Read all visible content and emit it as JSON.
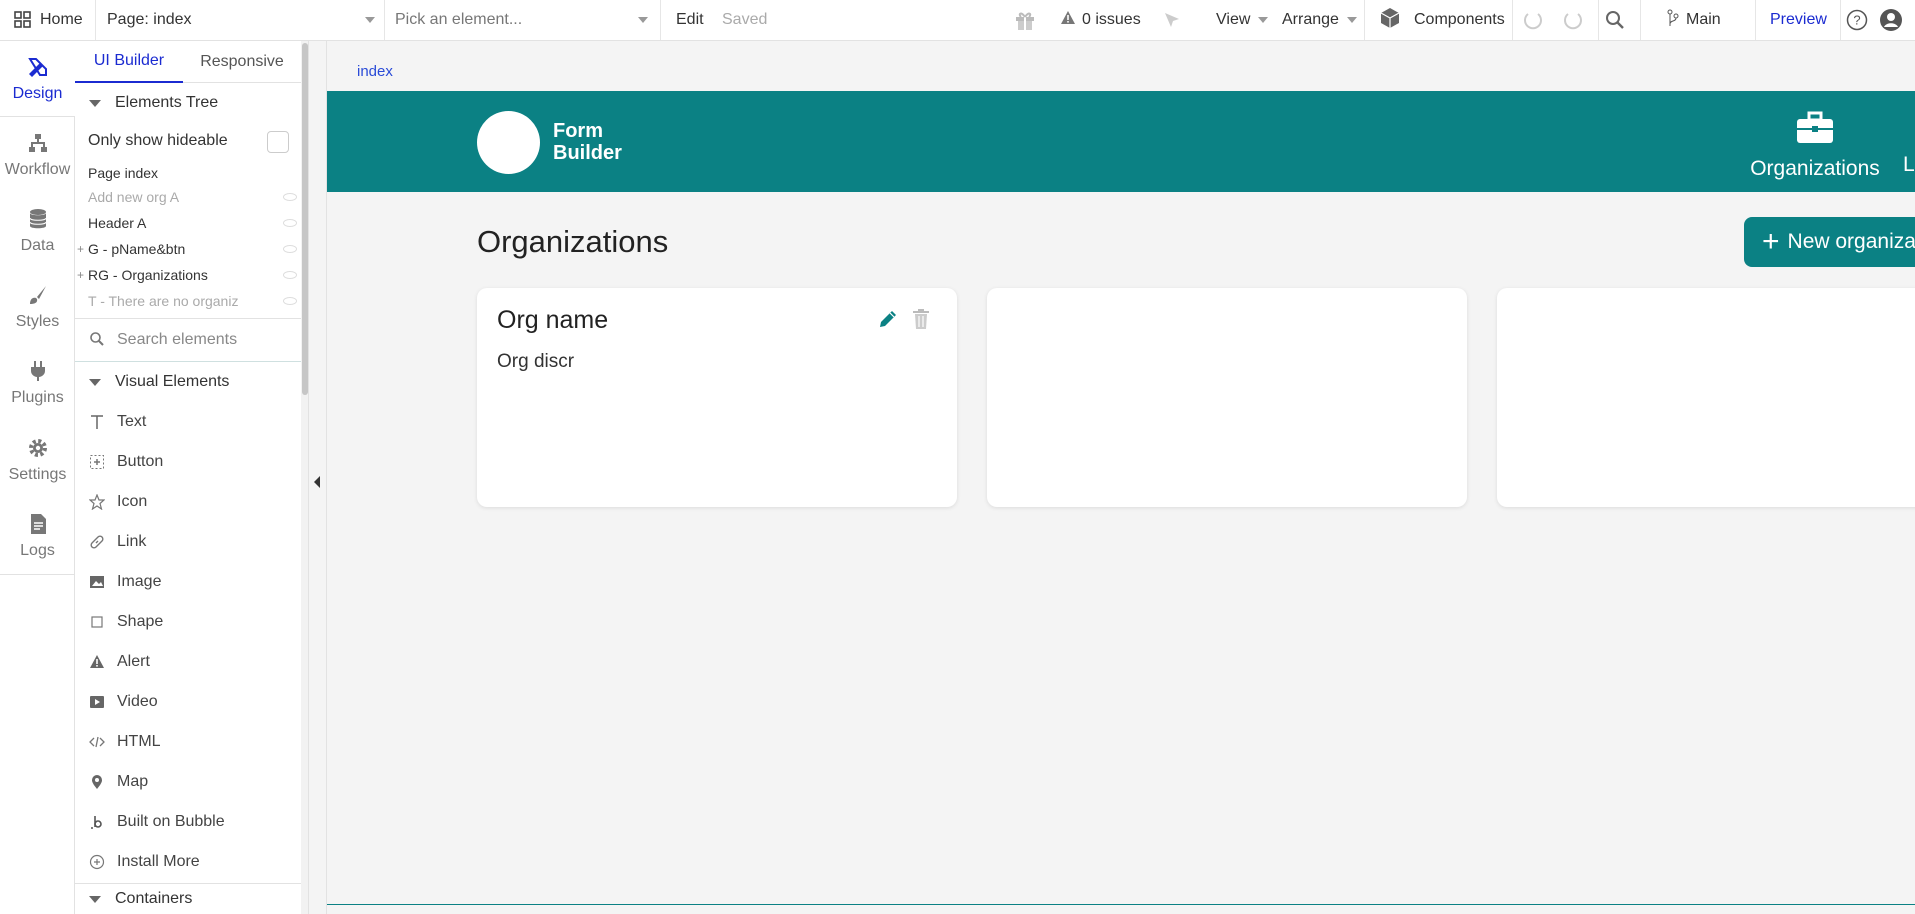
{
  "topbar": {
    "home_label": "Home",
    "page_select": "Page: index",
    "element_picker_placeholder": "Pick an element...",
    "edit_label": "Edit",
    "saved_label": "Saved",
    "issues_label": "0 issues",
    "view_label": "View",
    "arrange_label": "Arrange",
    "components_label": "Components",
    "branch_label": "Main",
    "preview_label": "Preview"
  },
  "rail": {
    "items": [
      {
        "label": "Design",
        "icon": "design-icon"
      },
      {
        "label": "Workflow",
        "icon": "workflow-icon"
      },
      {
        "label": "Data",
        "icon": "data-icon"
      },
      {
        "label": "Styles",
        "icon": "styles-icon"
      },
      {
        "label": "Plugins",
        "icon": "plugins-icon"
      },
      {
        "label": "Settings",
        "icon": "settings-icon"
      },
      {
        "label": "Logs",
        "icon": "logs-icon"
      }
    ]
  },
  "panel": {
    "tabs": [
      "UI Builder",
      "Responsive"
    ],
    "elements_tree_label": "Elements Tree",
    "only_show_hideable_label": "Only show hideable",
    "tree": [
      {
        "label": "Page index",
        "muted": false
      },
      {
        "label": "Add new org A",
        "muted": true
      },
      {
        "label": "Header A",
        "muted": false
      },
      {
        "label": "G - pName&btn",
        "muted": false
      },
      {
        "label": "RG - Organizations",
        "muted": false
      },
      {
        "label": "T - There are no organiz",
        "muted": true
      }
    ],
    "search_placeholder": "Search elements",
    "visual_elements_label": "Visual Elements",
    "visual_elements": [
      "Text",
      "Button",
      "Icon",
      "Link",
      "Image",
      "Shape",
      "Alert",
      "Video",
      "HTML",
      "Map",
      "Built on Bubble",
      "Install More"
    ],
    "containers_label": "Containers"
  },
  "canvas": {
    "page_label": "index",
    "header": {
      "brand_line1": "Form",
      "brand_line2": "Builder",
      "nav_organizations": "Organizations",
      "nav_cut": "L"
    },
    "title": "Organizations",
    "new_button_label": "New organiza",
    "card": {
      "title": "Org name",
      "description": "Org discr"
    }
  },
  "colors": {
    "brand_teal": "#0b8184",
    "accent_blue": "#1b2bd1",
    "canvas_bg": "#f4f4f4"
  }
}
